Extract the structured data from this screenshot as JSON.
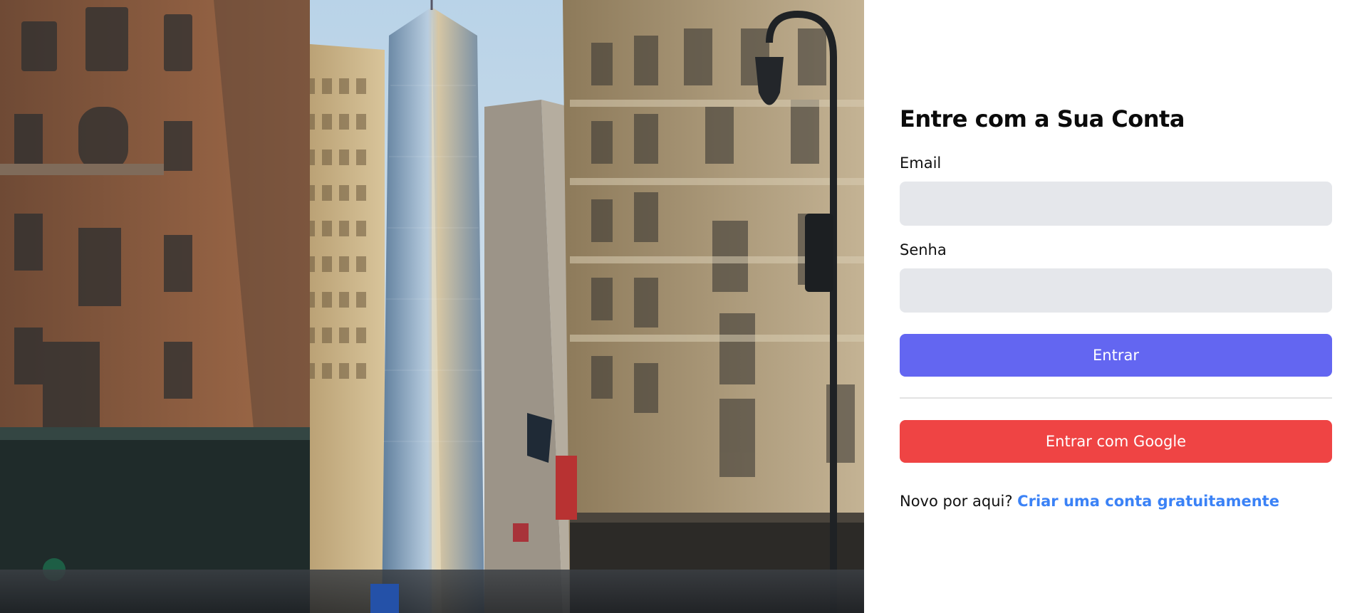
{
  "hero_image": {
    "description_icon": "city-street-photo",
    "colors": {
      "sky": "#a9c9e3",
      "tower": "#7f9bb6",
      "left_building": "#8a5a3e",
      "right_building": "#a9987a"
    }
  },
  "login": {
    "title": "Entre com a Sua Conta",
    "email_label": "Email",
    "email_value": "",
    "password_label": "Senha",
    "password_value": "",
    "submit_label": "Entrar",
    "google_label": "Entrar com Google",
    "signup_prompt": "Novo por aqui?",
    "signup_link": "Criar uma conta gratuitamente"
  },
  "colors": {
    "primary": "#6366f1",
    "google": "#ef4444",
    "link": "#3b82f6",
    "field_bg": "#e5e7eb"
  }
}
